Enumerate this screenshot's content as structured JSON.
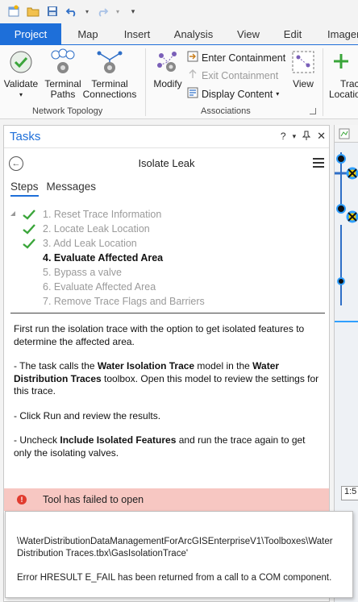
{
  "ribbon_tabs": [
    "Project",
    "Map",
    "Insert",
    "Analysis",
    "View",
    "Edit",
    "Imagery"
  ],
  "ribbon": {
    "validate_label": "Validate",
    "terminal_paths_line1": "Terminal",
    "terminal_paths_line2": "Paths",
    "terminal_connections_line1": "Terminal",
    "terminal_connections_line2": "Connections",
    "modify_label": "Modify",
    "enter_containment": "Enter Containment",
    "exit_containment": "Exit Containment",
    "display_content": "Display Content",
    "view_label": "View",
    "trace_line1": "Trac",
    "trace_line2": "Locatio",
    "group_network_topology": "Network Topology",
    "group_associations": "Associations"
  },
  "pane": {
    "title": "Tasks",
    "help": "?",
    "task_name": "Isolate Leak",
    "tab_steps": "Steps",
    "tab_messages": "Messages"
  },
  "steps": [
    {
      "label": "1.  Reset Trace Information",
      "done": true
    },
    {
      "label": "2.  Locate Leak Location",
      "done": true
    },
    {
      "label": "3.  Add Leak Location",
      "done": true
    },
    {
      "label": "4.  Evaluate Affected Area",
      "done": false,
      "current": true
    },
    {
      "label": "5.  Bypass a valve",
      "done": false
    },
    {
      "label": "6.  Evaluate Affected Area",
      "done": false
    },
    {
      "label": "7.  Remove Trace Flags and Barriers",
      "done": false
    }
  ],
  "instructions": {
    "p1": "First run the isolation trace with the option to get isolated features to determine the affected area.",
    "p2_a": "- The task calls the ",
    "p2_b": "Water Isolation Trace",
    "p2_c": " model in the ",
    "p2_d": "Water Distribution Traces",
    "p2_e": " toolbox. Open this model to review the settings for this trace.",
    "p3": "- Click Run and review the results.",
    "p4_a": "- Uncheck ",
    "p4_b": "Include Isolated Features",
    "p4_c": " and run the trace again to get only the isolating valves."
  },
  "error": {
    "text": "Tool has failed to open",
    "path": "\\WaterDistributionDataManagementForArcGISEnterpriseV1\\Toolboxes\\Water Distribution Traces.tbx\\GasIsolationTrace'",
    "message": "Error HRESULT E_FAIL has been returned from a call to a COM component."
  },
  "map": {
    "scale": "1:5"
  },
  "colors": {
    "accent": "#1e6fd9",
    "check": "#3aa53a",
    "error_bg": "#f7c7c2",
    "error_icon": "#e13b2e"
  }
}
